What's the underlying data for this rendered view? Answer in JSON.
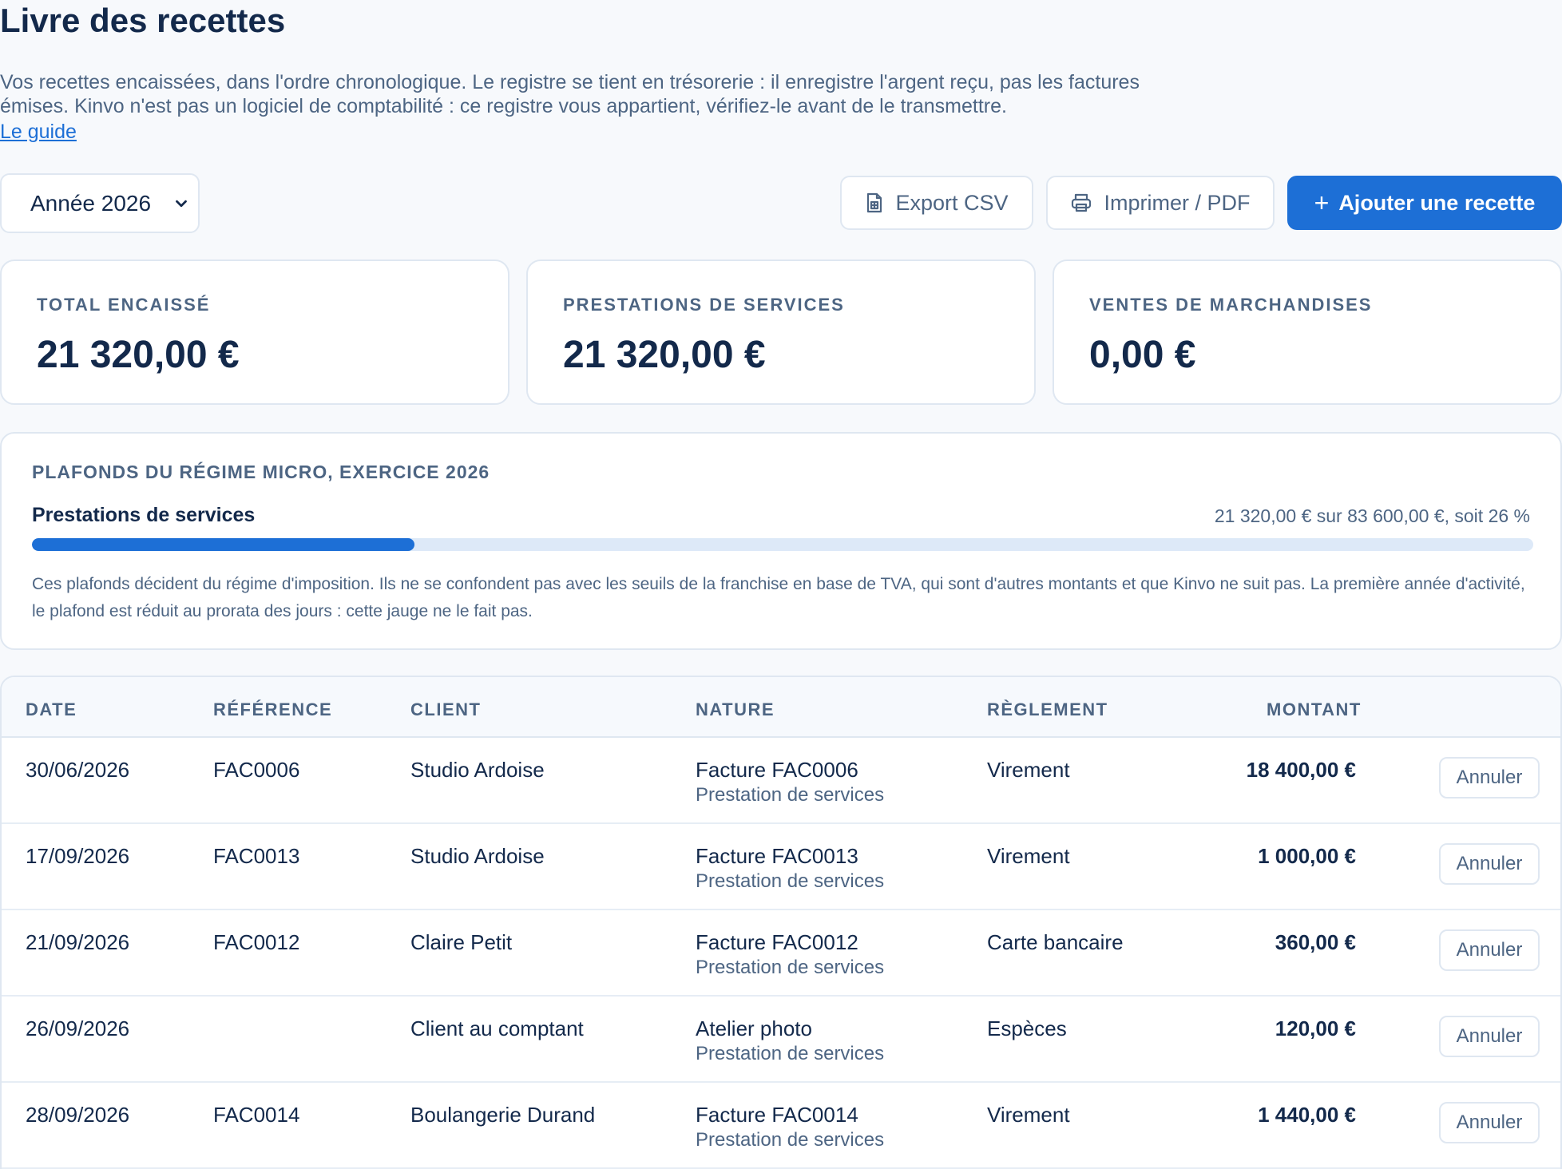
{
  "page": {
    "title": "Livre des recettes",
    "intro": "Vos recettes encaissées, dans l'ordre chronologique. Le registre se tient en trésorerie : il enregistre l'argent reçu, pas les factures émises. Kinvo n'est pas un logiciel de comptabilité : ce registre vous appartient, vérifiez-le avant de le transmettre.",
    "guide_link": "Le guide"
  },
  "toolbar": {
    "year_select": "Année 2026",
    "export_csv": "Export CSV",
    "print_pdf": "Imprimer / PDF",
    "add_receipt": "Ajouter une recette"
  },
  "stats": [
    {
      "label": "TOTAL ENCAISSÉ",
      "value": "21 320,00 €"
    },
    {
      "label": "PRESTATIONS DE SERVICES",
      "value": "21 320,00 €"
    },
    {
      "label": "VENTES DE MARCHANDISES",
      "value": "0,00 €"
    }
  ],
  "ceilings": {
    "title": "PLAFONDS DU RÉGIME MICRO, EXERCICE 2026",
    "category": "Prestations de services",
    "ratio_text": "21 320,00 € sur 83 600,00 €, soit 26 %",
    "progress_fraction": 0.255,
    "note": "Ces plafonds décident du régime d'imposition. Ils ne se confondent pas avec les seuils de la franchise en base de TVA, qui sont d'autres montants et que Kinvo ne suit pas. La première année d'activité, le plafond est réduit au prorata des jours : cette jauge ne le fait pas."
  },
  "table": {
    "headers": {
      "date": "DATE",
      "reference": "RÉFÉRENCE",
      "client": "CLIENT",
      "nature": "NATURE",
      "payment": "RÈGLEMENT",
      "amount": "MONTANT"
    },
    "cancel_label": "Annuler",
    "rows": [
      {
        "date": "30/06/2026",
        "reference": "FAC0006",
        "client": "Studio Ardoise",
        "nature": "Facture FAC0006",
        "nature_sub": "Prestation de services",
        "payment": "Virement",
        "amount": "18 400,00 €"
      },
      {
        "date": "17/09/2026",
        "reference": "FAC0013",
        "client": "Studio Ardoise",
        "nature": "Facture FAC0013",
        "nature_sub": "Prestation de services",
        "payment": "Virement",
        "amount": "1 000,00 €"
      },
      {
        "date": "21/09/2026",
        "reference": "FAC0012",
        "client": "Claire Petit",
        "nature": "Facture FAC0012",
        "nature_sub": "Prestation de services",
        "payment": "Carte bancaire",
        "amount": "360,00 €"
      },
      {
        "date": "26/09/2026",
        "reference": "",
        "client": "Client au comptant",
        "nature": "Atelier photo",
        "nature_sub": "Prestation de services",
        "payment": "Espèces",
        "amount": "120,00 €"
      },
      {
        "date": "28/09/2026",
        "reference": "FAC0014",
        "client": "Boulangerie Durand",
        "nature": "Facture FAC0014",
        "nature_sub": "Prestation de services",
        "payment": "Virement",
        "amount": "1 440,00 €"
      }
    ]
  },
  "colors": {
    "accent": "#1d6fd6",
    "title_text": "#13294b",
    "muted_text": "#4d6583",
    "border": "#dfe7f1",
    "progress_track": "#dde9f8"
  },
  "icons": {
    "export": "spreadsheet-file-icon",
    "print": "printer-icon",
    "add": "plus-icon",
    "select": "chevron-down-icon"
  }
}
